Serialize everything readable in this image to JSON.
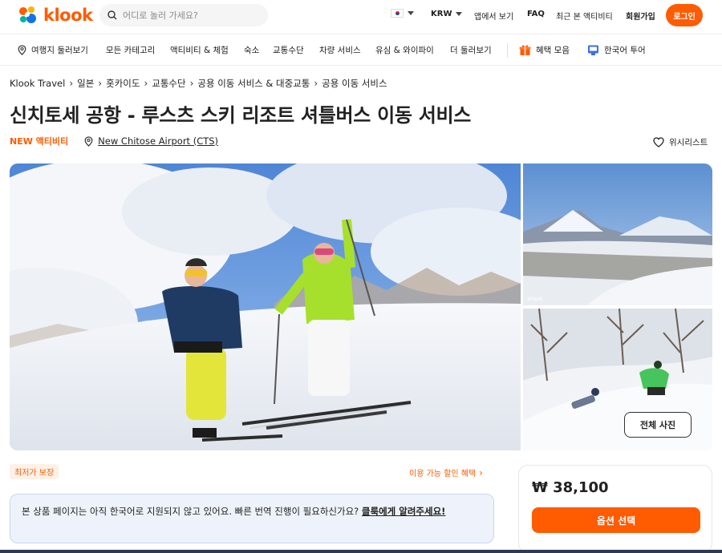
{
  "header": {
    "logo_text": "klook",
    "search_placeholder": "어디로 놀러 가세요?",
    "currency": "KRW",
    "app_link": "앱에서 보기",
    "faq": "FAQ",
    "recent": "최근 본 액티비티",
    "signup": "회원가입",
    "login": "로그인",
    "brand_color": "#ff5b00"
  },
  "nav": {
    "items": [
      "여행지 둘러보기",
      "모든 카테고리",
      "액티비티 & 체험",
      "숙소",
      "교통수단",
      "차량 서비스",
      "유심 & 와이파이",
      "더 둘러보기"
    ],
    "promo": "혜택 모음",
    "korean_tour": "한국어 투어"
  },
  "breadcrumb": [
    "Klook Travel",
    "일본",
    "홋카이도",
    "교통수단",
    "공용 이동 서비스 & 대중교통",
    "공용 이동 서비스"
  ],
  "product": {
    "title": "신치토세 공항 - 루스츠 스키 리조트 셔틀버스 이동 서비스",
    "badge": "NEW 액티비티",
    "location": "New Chitose Airport (CTS)",
    "wishlist": "위시리스트",
    "watermark": "klook"
  },
  "gallery": {
    "all_photos_label": "전체 사진"
  },
  "offers": {
    "price_guarantee": "최저가 보장",
    "discount_link": "이용 가능 할인 혜택"
  },
  "notice": {
    "text": "본 상품 페이지는 아직 한국어로 지원되지 않고 있어요. 빠른 번역 진행이 필요하신가요? ",
    "link": "클룩에게 알려주세요!"
  },
  "booking": {
    "price": "₩ 38,100",
    "select_label": "옵션 선택"
  }
}
